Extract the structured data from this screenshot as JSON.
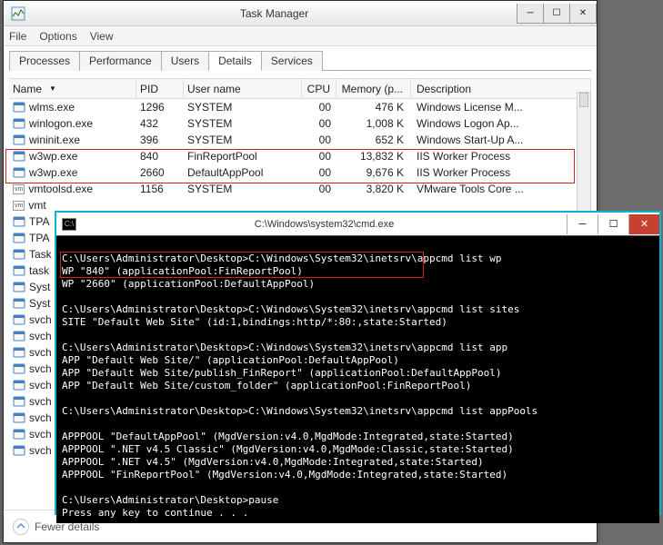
{
  "taskmgr": {
    "title": "Task Manager",
    "menu": [
      "File",
      "Options",
      "View"
    ],
    "tabs": [
      "Processes",
      "Performance",
      "Users",
      "Details",
      "Services"
    ],
    "active_tab": 3,
    "columns": {
      "name": "Name",
      "pid": "PID",
      "user": "User name",
      "cpu": "CPU",
      "mem": "Memory (p...",
      "desc": "Description"
    },
    "rows": [
      {
        "name": "wlms.exe",
        "pid": "1296",
        "user": "SYSTEM",
        "cpu": "00",
        "mem": "476 K",
        "desc": "Windows License M...",
        "icon": "app"
      },
      {
        "name": "winlogon.exe",
        "pid": "432",
        "user": "SYSTEM",
        "cpu": "00",
        "mem": "1,008 K",
        "desc": "Windows Logon Ap...",
        "icon": "app"
      },
      {
        "name": "wininit.exe",
        "pid": "396",
        "user": "SYSTEM",
        "cpu": "00",
        "mem": "652 K",
        "desc": "Windows Start-Up A...",
        "icon": "app"
      },
      {
        "name": "w3wp.exe",
        "pid": "840",
        "user": "FinReportPool",
        "cpu": "00",
        "mem": "13,832 K",
        "desc": "IIS Worker Process",
        "icon": "app"
      },
      {
        "name": "w3wp.exe",
        "pid": "2660",
        "user": "DefaultAppPool",
        "cpu": "00",
        "mem": "9,676 K",
        "desc": "IIS Worker Process",
        "icon": "app"
      },
      {
        "name": "vmtoolsd.exe",
        "pid": "1156",
        "user": "SYSTEM",
        "cpu": "00",
        "mem": "3,820 K",
        "desc": "VMware Tools Core ...",
        "icon": "vm"
      },
      {
        "name": "vmt",
        "pid": "",
        "user": "",
        "cpu": "",
        "mem": "",
        "desc": "",
        "icon": "vm"
      },
      {
        "name": "TPA",
        "pid": "",
        "user": "",
        "cpu": "",
        "mem": "",
        "desc": "",
        "icon": "app"
      },
      {
        "name": "TPA",
        "pid": "",
        "user": "",
        "cpu": "",
        "mem": "",
        "desc": "",
        "icon": "app"
      },
      {
        "name": "Task",
        "pid": "",
        "user": "",
        "cpu": "",
        "mem": "",
        "desc": "",
        "icon": "app"
      },
      {
        "name": "task",
        "pid": "",
        "user": "",
        "cpu": "",
        "mem": "",
        "desc": "",
        "icon": "app"
      },
      {
        "name": "Syst",
        "pid": "",
        "user": "",
        "cpu": "",
        "mem": "",
        "desc": "",
        "icon": "app"
      },
      {
        "name": "Syst",
        "pid": "",
        "user": "",
        "cpu": "",
        "mem": "",
        "desc": "",
        "icon": "app"
      },
      {
        "name": "svch",
        "pid": "",
        "user": "",
        "cpu": "",
        "mem": "",
        "desc": "",
        "icon": "app"
      },
      {
        "name": "svch",
        "pid": "",
        "user": "",
        "cpu": "",
        "mem": "",
        "desc": "",
        "icon": "app"
      },
      {
        "name": "svch",
        "pid": "",
        "user": "",
        "cpu": "",
        "mem": "",
        "desc": "",
        "icon": "app"
      },
      {
        "name": "svch",
        "pid": "",
        "user": "",
        "cpu": "",
        "mem": "",
        "desc": "",
        "icon": "app"
      },
      {
        "name": "svch",
        "pid": "",
        "user": "",
        "cpu": "",
        "mem": "",
        "desc": "",
        "icon": "app"
      },
      {
        "name": "svch",
        "pid": "",
        "user": "",
        "cpu": "",
        "mem": "",
        "desc": "",
        "icon": "app"
      },
      {
        "name": "svch",
        "pid": "",
        "user": "",
        "cpu": "",
        "mem": "",
        "desc": "",
        "icon": "app"
      },
      {
        "name": "svch",
        "pid": "",
        "user": "",
        "cpu": "",
        "mem": "",
        "desc": "",
        "icon": "app"
      },
      {
        "name": "svch",
        "pid": "",
        "user": "",
        "cpu": "",
        "mem": "",
        "desc": "",
        "icon": "app"
      }
    ],
    "fewer_label": "Fewer details",
    "btn_min": "─",
    "btn_max": "☐",
    "btn_close": "✕"
  },
  "cmd": {
    "title": "C:\\Windows\\system32\\cmd.exe",
    "btn_min": "─",
    "btn_max": "☐",
    "btn_close": "✕",
    "lines": [
      "",
      "C:\\Users\\Administrator\\Desktop>C:\\Windows\\System32\\inetsrv\\appcmd list wp",
      "WP \"840\" (applicationPool:FinReportPool)",
      "WP \"2660\" (applicationPool:DefaultAppPool)",
      "",
      "C:\\Users\\Administrator\\Desktop>C:\\Windows\\System32\\inetsrv\\appcmd list sites",
      "SITE \"Default Web Site\" (id:1,bindings:http/*:80:,state:Started)",
      "",
      "C:\\Users\\Administrator\\Desktop>C:\\Windows\\System32\\inetsrv\\appcmd list app",
      "APP \"Default Web Site/\" (applicationPool:DefaultAppPool)",
      "APP \"Default Web Site/publish_FinReport\" (applicationPool:DefaultAppPool)",
      "APP \"Default Web Site/custom_folder\" (applicationPool:FinReportPool)",
      "",
      "C:\\Users\\Administrator\\Desktop>C:\\Windows\\System32\\inetsrv\\appcmd list appPools",
      "",
      "APPPOOL \"DefaultAppPool\" (MgdVersion:v4.0,MgdMode:Integrated,state:Started)",
      "APPPOOL \".NET v4.5 Classic\" (MgdVersion:v4.0,MgdMode:Classic,state:Started)",
      "APPPOOL \".NET v4.5\" (MgdVersion:v4.0,MgdMode:Integrated,state:Started)",
      "APPPOOL \"FinReportPool\" (MgdVersion:v4.0,MgdMode:Integrated,state:Started)",
      "",
      "C:\\Users\\Administrator\\Desktop>pause",
      "Press any key to continue . . ."
    ]
  }
}
